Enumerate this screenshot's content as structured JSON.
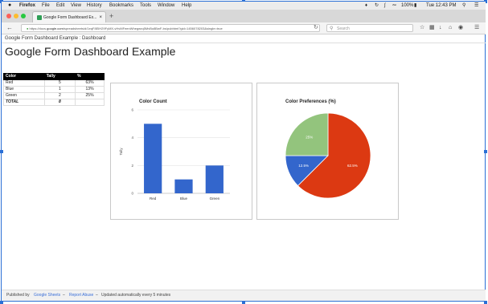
{
  "menubar": {
    "apple": "",
    "items": [
      "Firefox",
      "File",
      "Edit",
      "View",
      "History",
      "Bookmarks",
      "Tools",
      "Window",
      "Help"
    ],
    "battery": "100%",
    "clock": "Tue 12:43 PM"
  },
  "browser": {
    "tab_title": "Google Form Dashboard Ex...",
    "url_prefix": "https://docs.",
    "url_domain": "google.com",
    "url_rest": "/spreadsheets/d/1eqF8EiH29FyMX-vHvMFeenWhegwrq5MvBo8BwF-bs/pubhtml?gid=1456078203&single=true",
    "search_placeholder": "Search"
  },
  "page": {
    "breadcrumb": "Google Form Dashboard Example : Dashboard",
    "title": "Google Form Dashboard Example"
  },
  "table": {
    "headers": [
      "Color",
      "Tally",
      "%"
    ],
    "rows": [
      [
        "Red",
        "5",
        "63%"
      ],
      [
        "Blue",
        "1",
        "13%"
      ],
      [
        "Green",
        "2",
        "25%"
      ]
    ],
    "total": [
      "TOTAL",
      "8",
      ""
    ]
  },
  "chart_data": [
    {
      "type": "bar",
      "title": "Color Count",
      "ylabel": "Tally",
      "xlabel": "",
      "categories": [
        "Red",
        "Blue",
        "Green"
      ],
      "values": [
        5,
        1,
        2
      ],
      "ylim": [
        0,
        6
      ],
      "yticks": [
        0,
        2,
        4,
        6
      ],
      "color": "#3366cc",
      "grid": true
    },
    {
      "type": "pie",
      "title": "Color Preferences (%)",
      "labels": [
        "Red",
        "Blue",
        "Green"
      ],
      "values": [
        62.5,
        12.5,
        25
      ],
      "slice_labels": [
        "62.5%",
        "12.5%",
        "25%"
      ],
      "colors": [
        "#dc3912",
        "#3366cc",
        "#93c47d"
      ]
    }
  ],
  "footer": {
    "published_by": "Published by",
    "google_sheets": "Google Sheets",
    "sep1": "–",
    "report_abuse": "Report Abuse",
    "sep2": "–",
    "updated": "Updated automatically every 5 minutes"
  },
  "colors": {
    "accent": "#2a6fd6",
    "link": "#3a6fd8",
    "table_header_bg": "#000000"
  }
}
